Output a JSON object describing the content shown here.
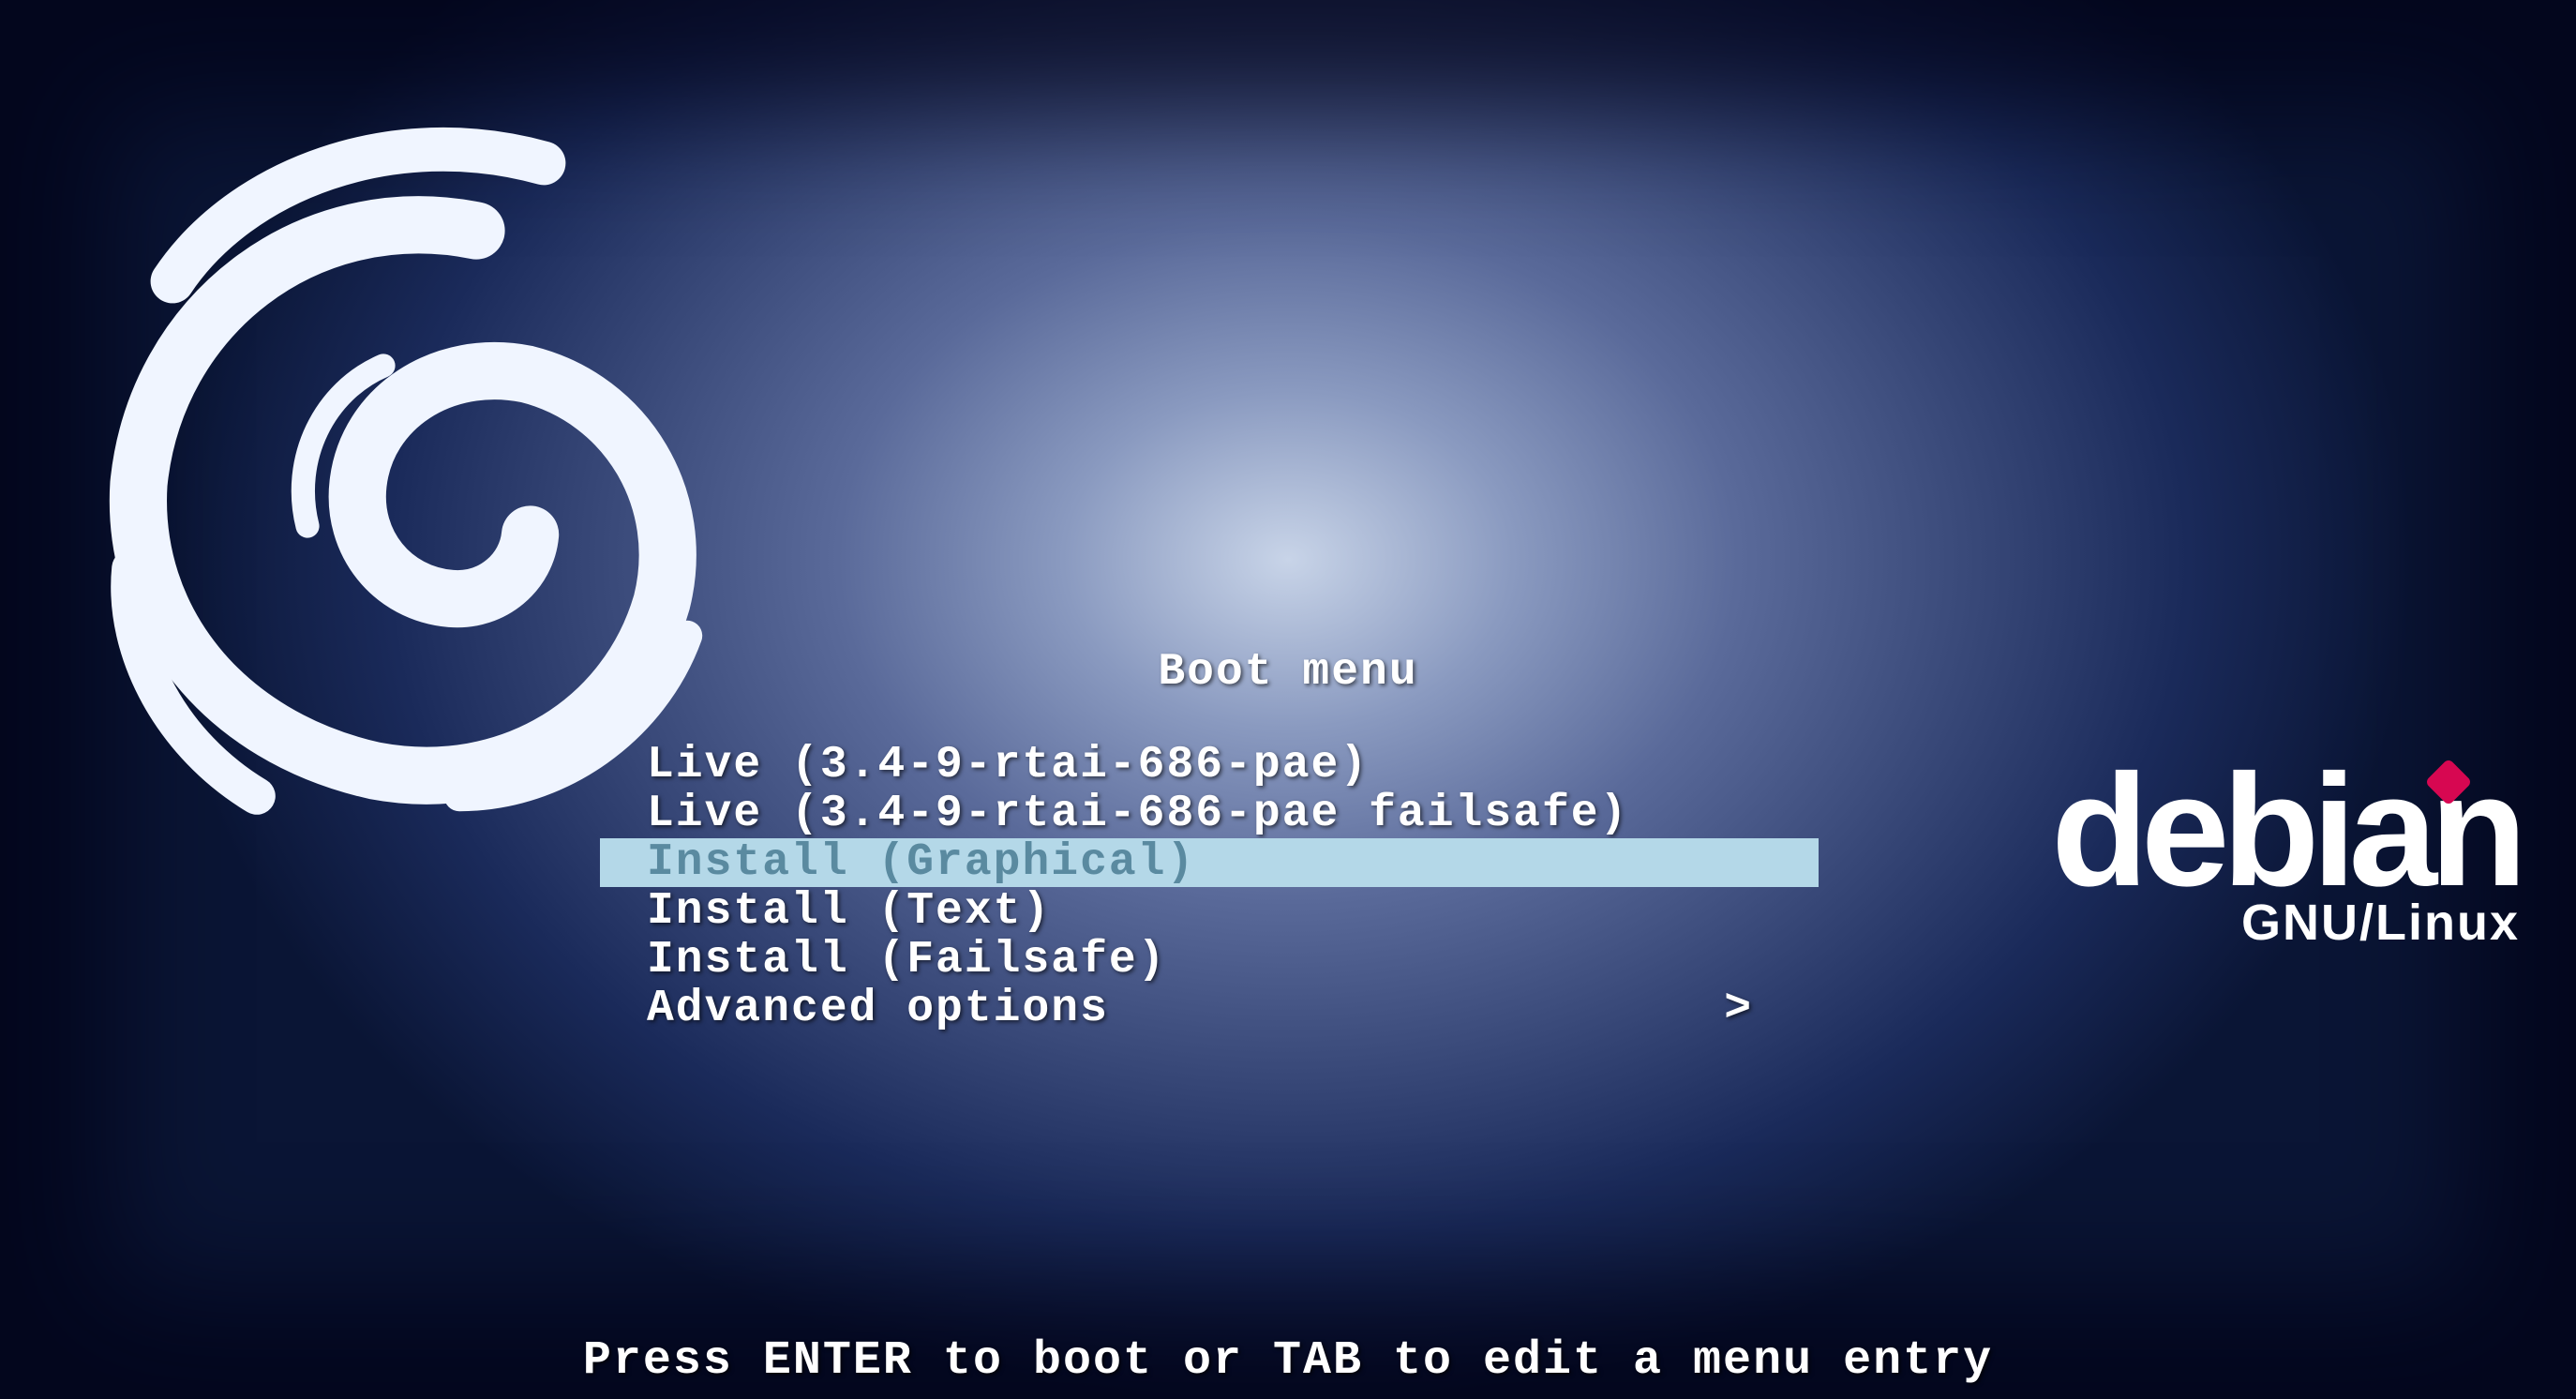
{
  "menu": {
    "title": "Boot menu",
    "items": [
      {
        "label": "Live (3.4-9-rtai-686-pae)",
        "selected": false,
        "submenu": false
      },
      {
        "label": "Live (3.4-9-rtai-686-pae failsafe)",
        "selected": false,
        "submenu": false
      },
      {
        "label": "Install (Graphical)",
        "selected": true,
        "submenu": false
      },
      {
        "label": "Install (Text)",
        "selected": false,
        "submenu": false
      },
      {
        "label": "Install (Failsafe)",
        "selected": false,
        "submenu": false
      },
      {
        "label": "Advanced options",
        "selected": false,
        "submenu": true
      }
    ]
  },
  "footer": {
    "hint": "Press ENTER to boot or TAB to edit a menu entry"
  },
  "brand": {
    "name": "debian",
    "subtitle": "GNU/Linux"
  },
  "submenu_glyph": ">"
}
